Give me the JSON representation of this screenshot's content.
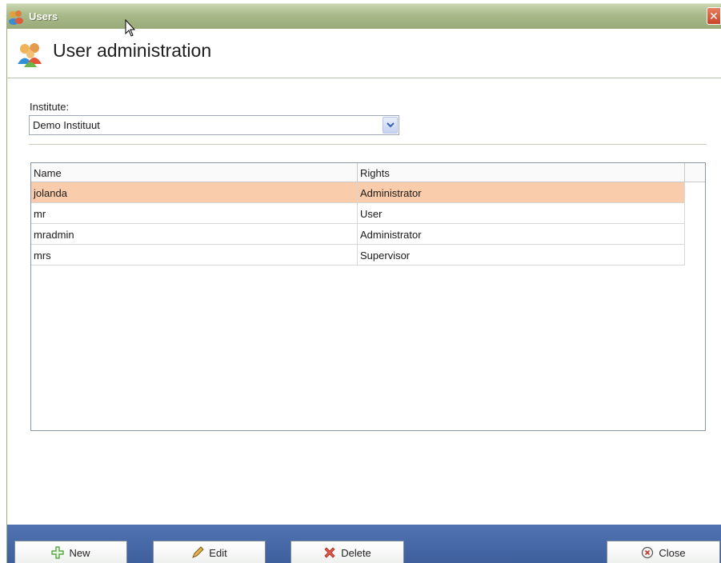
{
  "titlebar": {
    "title": "Users",
    "close_glyph": "✕"
  },
  "header": {
    "heading": "User administration",
    "icon": "users-icon"
  },
  "institute": {
    "label": "Institute:",
    "selected": "Demo Instituut"
  },
  "table": {
    "columns": [
      "Name",
      "Rights"
    ],
    "rows": [
      {
        "name": "jolanda",
        "rights": "Administrator",
        "selected": true
      },
      {
        "name": "mr",
        "rights": "User",
        "selected": false
      },
      {
        "name": "mradmin",
        "rights": "Administrator",
        "selected": false
      },
      {
        "name": "mrs",
        "rights": "Supervisor",
        "selected": false
      }
    ]
  },
  "buttons": {
    "new": {
      "label": "New",
      "icon": "plus-icon"
    },
    "edit": {
      "label": "Edit",
      "icon": "pencil-icon"
    },
    "delete": {
      "label": "Delete",
      "icon": "delete-x-icon"
    },
    "close": {
      "label": "Close",
      "icon": "close-circle-icon"
    }
  },
  "colors": {
    "selected_row": "#f9cdab",
    "bottom_bar": "#4a6aa8",
    "title_bar": "#a8b98a"
  }
}
